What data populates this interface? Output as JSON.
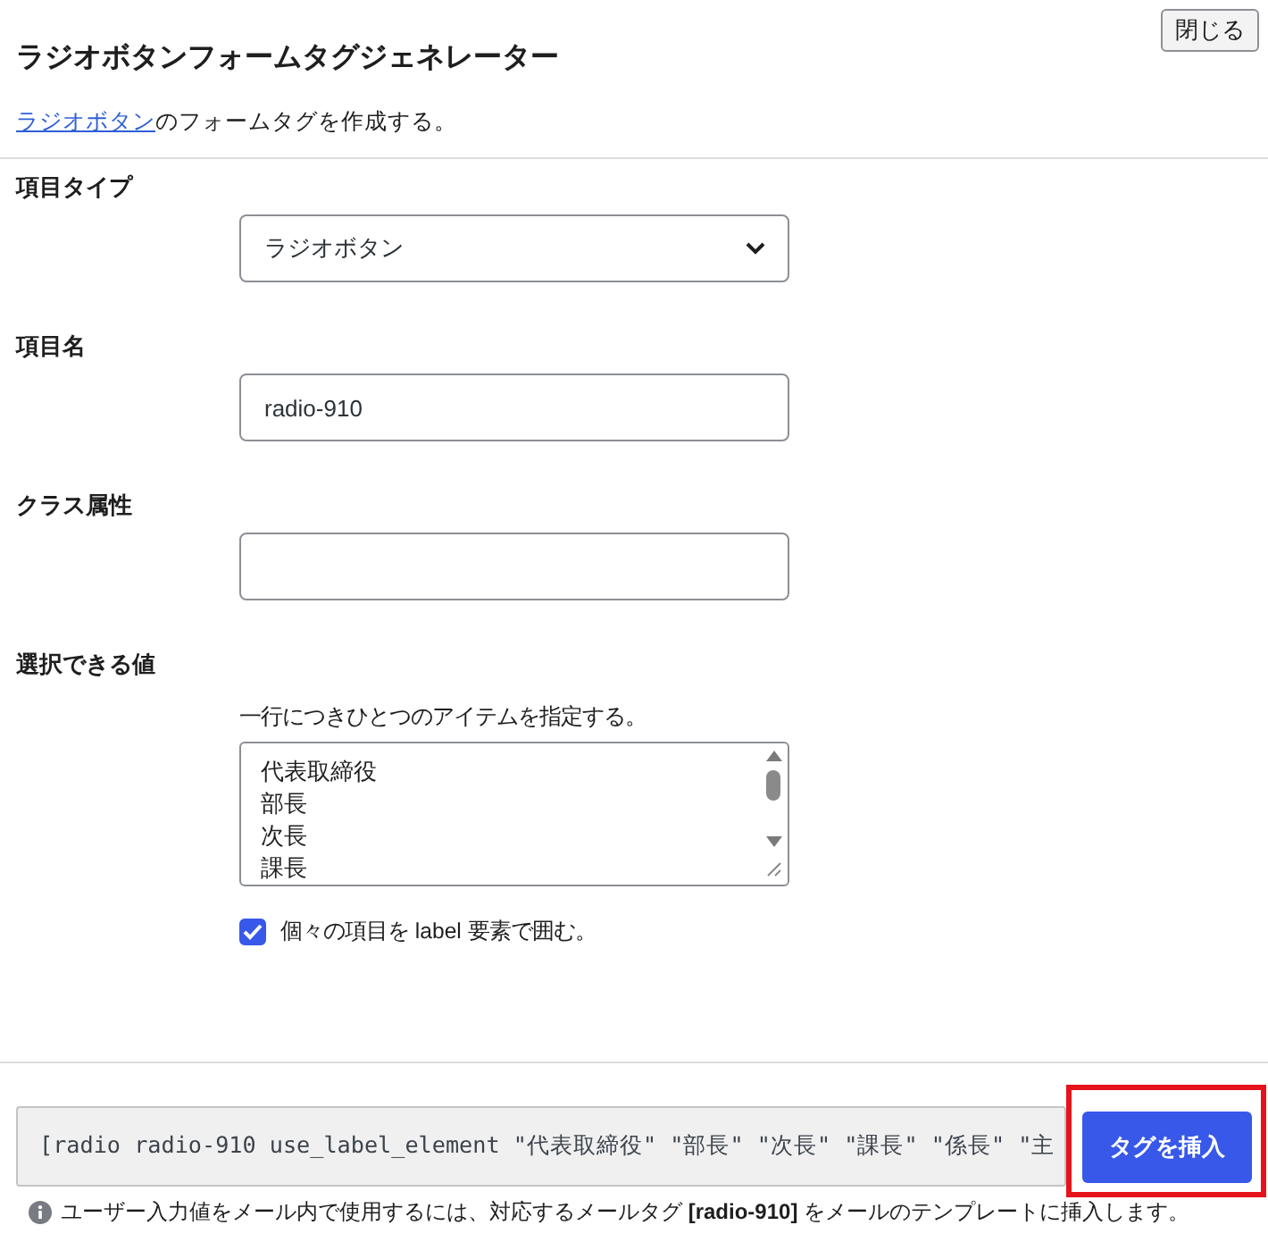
{
  "dialog": {
    "close_button": "閉じる",
    "title": "ラジオボタンフォームタグジェネレーター",
    "description": {
      "link": "ラジオボタン",
      "text": "のフォームタグを作成する。"
    }
  },
  "fields": [
    {
      "kind": "select",
      "label": "項目タイプ",
      "value": "ラジオボタン"
    },
    {
      "kind": "text",
      "label": "項目名",
      "value": "radio-910"
    },
    {
      "kind": "text",
      "label": "クラス属性"
    },
    {
      "kind": "options",
      "label": "選択できる値",
      "hint": "一行につきひとつのアイテムを指定する。",
      "values": [
        "代表取締役",
        "部長",
        "次長",
        "課長"
      ],
      "checkbox": {
        "label": "個々の項目を label 要素で囲む。",
        "checked": true
      }
    }
  ],
  "footer": {
    "tag_code": "[radio radio-910 use_label_element \"代表取締役\" \"部長\" \"次長\" \"課長\" \"係長\" \"主",
    "insert_button": {
      "label": "タグを挿入",
      "highlighted": true
    },
    "note": "ユーザー入力値をメール内で使用するには、対応するメールタグ **[radio-910]** をメールのテンプレートに挿入します。"
  }
}
